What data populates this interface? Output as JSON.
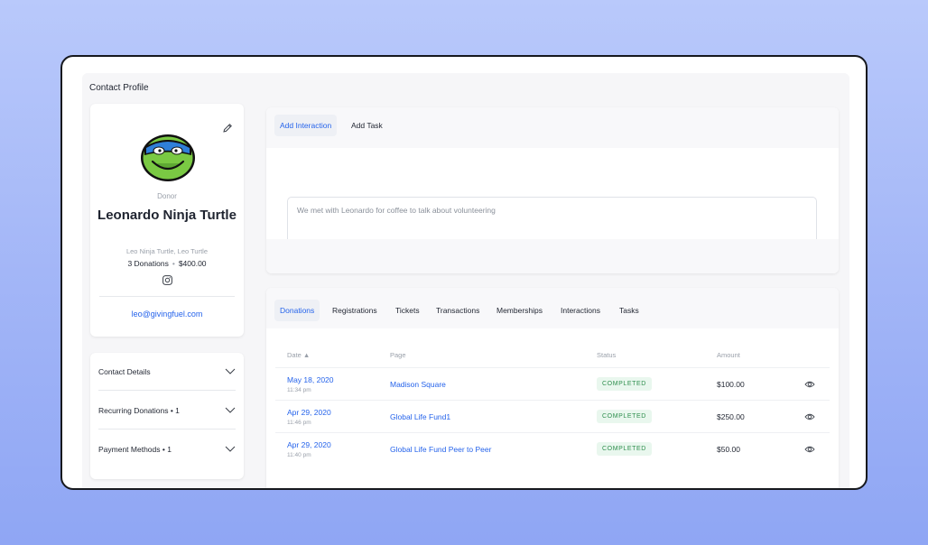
{
  "page": {
    "title": "Contact Profile"
  },
  "profile": {
    "role": "Donor",
    "name": "Leonardo Ninja Turtle",
    "aliases": "Leo Ninja Turtle, Leo Turtle",
    "donations_count": "3 Donations",
    "stats_separator": "•",
    "total": "$400.00",
    "email": "leo@givingfuel.com",
    "icons": {
      "edit": "pencil-icon",
      "social": "instagram-icon",
      "avatar": "turtle-avatar"
    }
  },
  "accordion": [
    {
      "label": "Contact Details"
    },
    {
      "label": "Recurring Donations  •  1"
    },
    {
      "label": "Payment Methods  •  1"
    }
  ],
  "interaction": {
    "tabs": [
      "Add Interaction",
      "Add Task"
    ],
    "active_tab": "Add Interaction",
    "note_value": "We met with Leonardo for coffee to talk about volunteering"
  },
  "records": {
    "tabs": [
      "Donations",
      "Registrations",
      "Tickets",
      "Transactions",
      "Memberships",
      "Interactions",
      "Tasks"
    ],
    "active_tab": "Donations",
    "columns": {
      "date": "Date ▲",
      "page": "Page",
      "status": "Status",
      "amount": "Amount"
    },
    "rows": [
      {
        "date": "May 18, 2020",
        "time": "11:34 pm",
        "page": "Madison Square",
        "status": "COMPLETED",
        "amount": "$100.00"
      },
      {
        "date": "Apr 29, 2020",
        "time": "11:46 pm",
        "page": "Global Life Fund1",
        "status": "COMPLETED",
        "amount": "$250.00"
      },
      {
        "date": "Apr 29, 2020",
        "time": "11:40 pm",
        "page": "Global Life Fund Peer to Peer",
        "status": "COMPLETED",
        "amount": "$50.00"
      }
    ]
  },
  "colors": {
    "accent": "#2563eb",
    "status_text": "#2f8f4e",
    "status_bg": "#e9f7ee",
    "background": "#a3b6f7",
    "avatar_green": "#7ac943",
    "avatar_mask": "#2f7fd9"
  }
}
